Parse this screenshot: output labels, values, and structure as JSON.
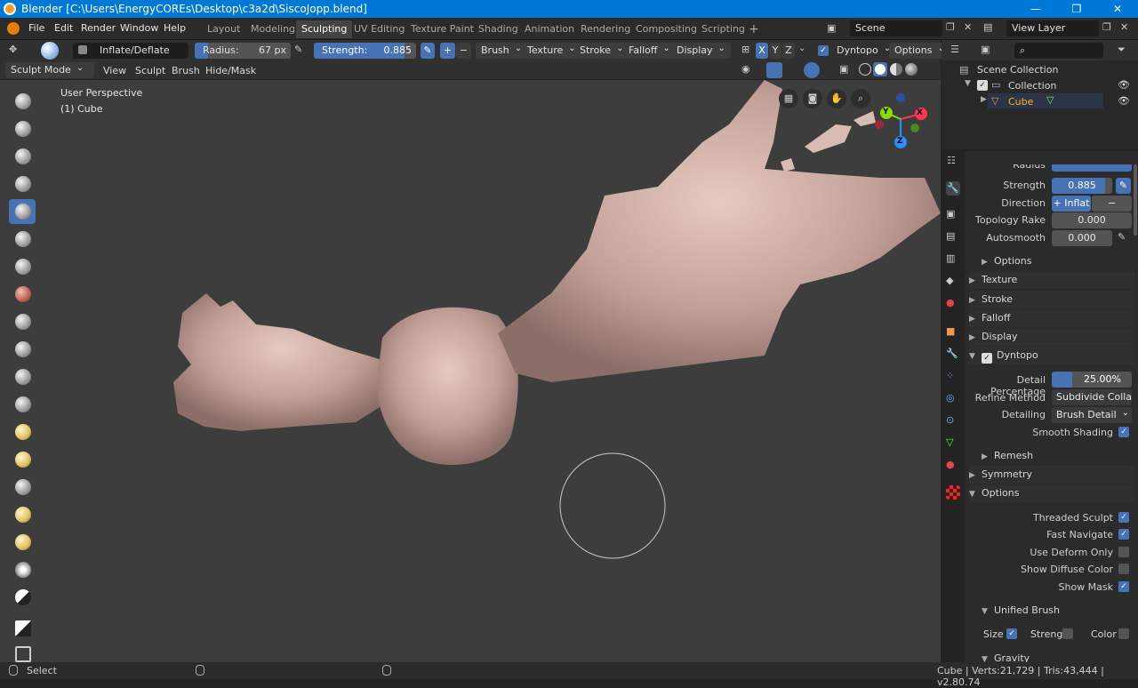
{
  "window": {
    "title": "Blender [C:\\Users\\EnergyCOREs\\Desktop\\c3a2d\\SiscoJopp.blend]",
    "controls": [
      "—",
      "❐",
      "✕"
    ]
  },
  "menus": [
    "File",
    "Edit",
    "Render",
    "Window",
    "Help"
  ],
  "workspaces": {
    "tabs": [
      "Layout",
      "Modeling",
      "Sculpting",
      "UV Editing",
      "Texture Paint",
      "Shading",
      "Animation",
      "Rendering",
      "Compositing",
      "Scripting"
    ],
    "active": "Sculpting",
    "add_label": "+"
  },
  "scene": {
    "value": "Scene"
  },
  "view_layer": {
    "value": "View Layer"
  },
  "tool_header": {
    "brush_name": "Inflate/Deflate",
    "radius_label": "Radius:",
    "radius_value": "67 px",
    "strength_label": "Strength:",
    "strength_value": "0.885",
    "strength_fraction": 0.885,
    "plus": "+",
    "minus": "−",
    "dropdowns": [
      "Brush",
      "Texture",
      "Stroke",
      "Falloff",
      "Display"
    ],
    "axes": [
      "X",
      "Y",
      "Z"
    ],
    "dyntopo": "Dyntopo",
    "options": "Options"
  },
  "mode_header": {
    "mode": "Sculpt Mode",
    "menus": [
      "View",
      "Sculpt",
      "Brush",
      "Hide/Mask"
    ]
  },
  "viewport": {
    "overlay_line1": "User Perspective",
    "overlay_line2": "(1) Cube",
    "gizmo": {
      "x": "X",
      "y": "Y",
      "z": "Z"
    }
  },
  "outliner": {
    "items": [
      "Scene Collection",
      "Collection",
      "Cube"
    ]
  },
  "properties": {
    "partial_label": "Radius",
    "strength_label": "Strength",
    "strength_value": "0.885",
    "direction_label": "Direction",
    "direction_on": "+ Inflat",
    "direction_off": "− Deflat",
    "topology_label": "Topology Rake",
    "topology_value": "0.000",
    "autosmooth_label": "Autosmooth",
    "autosmooth_value": "0.000",
    "options_sub": "Options",
    "sections": [
      "Texture",
      "Stroke",
      "Falloff",
      "Display"
    ],
    "dyntopo": "Dyntopo",
    "detail_pct_label": "Detail Percentage",
    "detail_pct_value": "25.00%",
    "detail_pct_fraction": 0.25,
    "refine_label": "Refine Method",
    "refine_value": "Subdivide Colla...",
    "detailing_label": "Detailing",
    "detailing_value": "Brush Detail",
    "smooth_shading": "Smooth Shading",
    "remesh": "Remesh",
    "symmetry": "Symmetry",
    "options": "Options",
    "threaded": "Threaded Sculpt",
    "fast_nav": "Fast Navigate",
    "deform_only": "Use Deform Only",
    "diffuse": "Show Diffuse Color",
    "show_mask": "Show Mask",
    "unified": "Unified Brush",
    "size": "Size",
    "streng": "Streng",
    "color": "Color",
    "gravity": "Gravity"
  },
  "status": {
    "select": "Select",
    "info": "Cube | Verts:21,729 | Tris:43,444 | v2.80.74"
  },
  "colors": {
    "accent": "#4772b3",
    "title": "#0078d7",
    "viewport": "#3d3d3d",
    "mesh": "#c9aaa2"
  }
}
